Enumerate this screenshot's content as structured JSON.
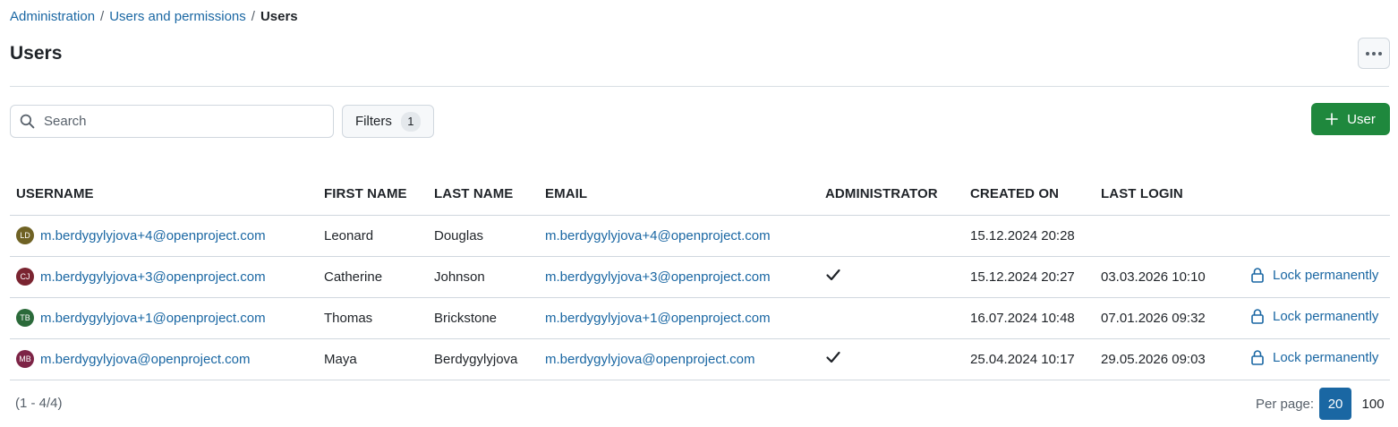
{
  "breadcrumb": {
    "items": [
      "Administration",
      "Users and permissions"
    ],
    "separator": "/",
    "current": "Users"
  },
  "page": {
    "title": "Users"
  },
  "search": {
    "placeholder": "Search"
  },
  "filters": {
    "label": "Filters",
    "count": "1"
  },
  "add_button": {
    "label": "User"
  },
  "table": {
    "columns": [
      "USERNAME",
      "FIRST NAME",
      "LAST NAME",
      "EMAIL",
      "ADMINISTRATOR",
      "CREATED ON",
      "LAST LOGIN"
    ],
    "rows": [
      {
        "initials": "LD",
        "avatar_color": "#6f6224",
        "username": "m.berdygylyjova+4@openproject.com",
        "first_name": "Leonard",
        "last_name": "Douglas",
        "email": "m.berdygylyjova+4@openproject.com",
        "admin": false,
        "created_on": "15.12.2024 20:28",
        "last_login": "",
        "action": ""
      },
      {
        "initials": "CJ",
        "avatar_color": "#7a2430",
        "username": "m.berdygylyjova+3@openproject.com",
        "first_name": "Catherine",
        "last_name": "Johnson",
        "email": "m.berdygylyjova+3@openproject.com",
        "admin": true,
        "created_on": "15.12.2024 20:27",
        "last_login": "03.03.2026 10:10",
        "action": "Lock permanently"
      },
      {
        "initials": "TB",
        "avatar_color": "#2b6a3a",
        "username": "m.berdygylyjova+1@openproject.com",
        "first_name": "Thomas",
        "last_name": "Brickstone",
        "email": "m.berdygylyjova+1@openproject.com",
        "admin": false,
        "created_on": "16.07.2024 10:48",
        "last_login": "07.01.2026 09:32",
        "action": "Lock permanently"
      },
      {
        "initials": "MB",
        "avatar_color": "#7d2446",
        "username": "m.berdygylyjova@openproject.com",
        "first_name": "Maya",
        "last_name": "Berdygylyjova",
        "email": "m.berdygylyjova@openproject.com",
        "admin": true,
        "created_on": "25.04.2024 10:17",
        "last_login": "29.05.2026 09:03",
        "action": "Lock permanently"
      }
    ]
  },
  "pagination": {
    "info": "(1 - 4/4)",
    "per_page_label": "Per page:",
    "options": [
      "20",
      "100"
    ],
    "selected": "20"
  },
  "colors": {
    "link": "#1a67a3",
    "primary": "#1f883d",
    "active_page": "#1a67a3"
  }
}
